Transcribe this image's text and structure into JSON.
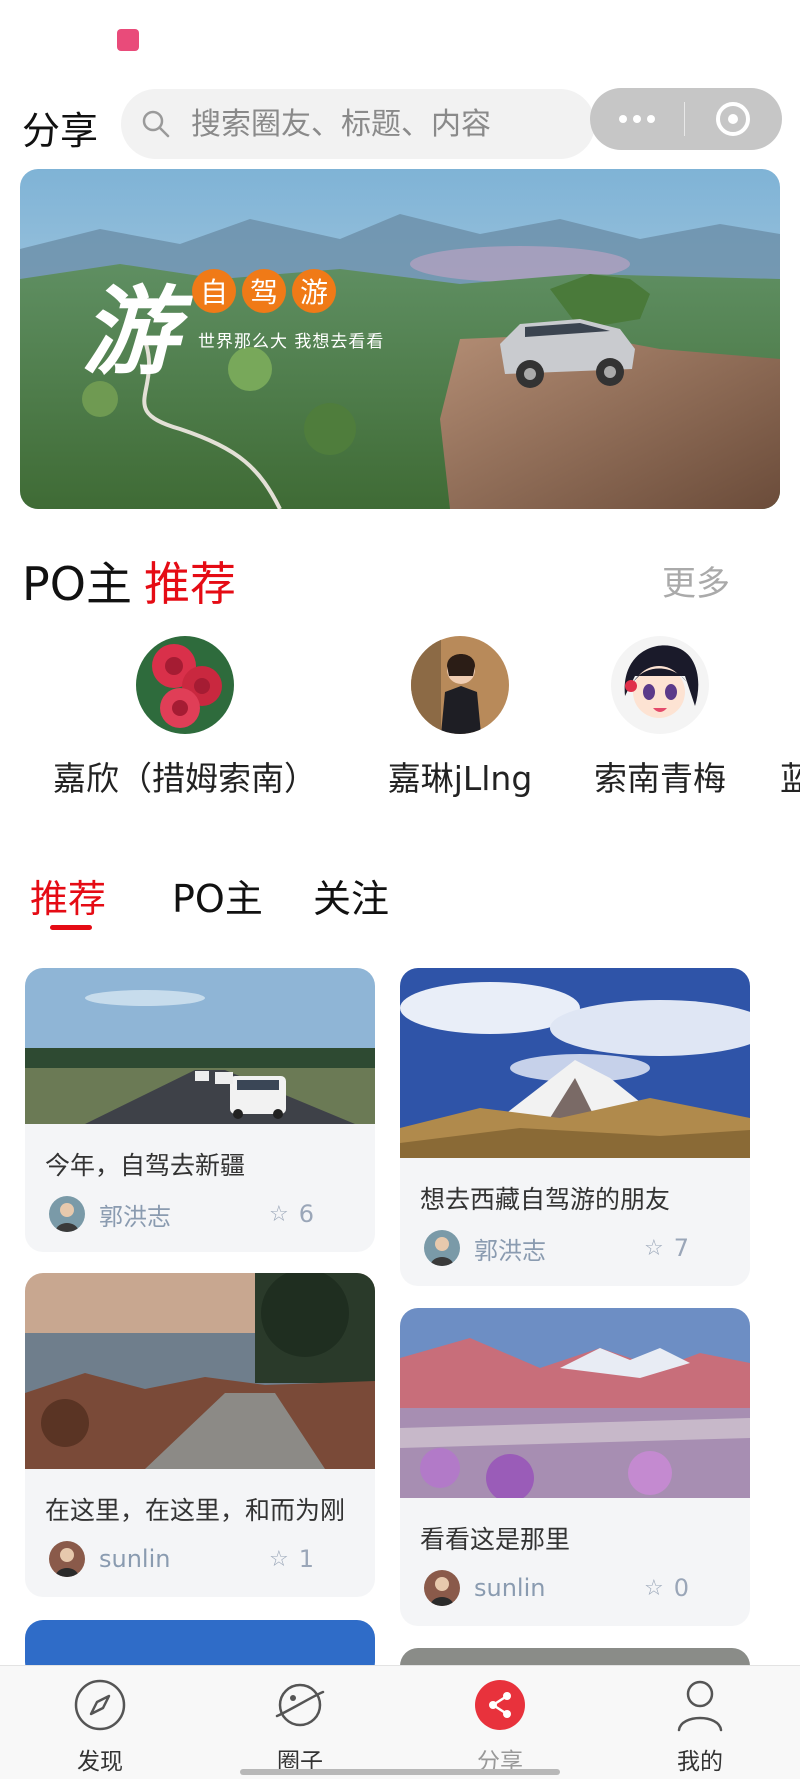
{
  "header": {
    "title": "分享",
    "search_placeholder": "搜索圈友、标题、内容"
  },
  "banner": {
    "brush_char": "游",
    "chips": [
      "自",
      "驾",
      "游"
    ],
    "slogan": "世界那么大 我想去看看"
  },
  "po_section": {
    "title_black": "PO主",
    "title_red": "推荐",
    "more_label": "更多",
    "creators": [
      {
        "name": "嘉欣（措姆索南）",
        "avatar": "roses-avatar"
      },
      {
        "name": "嘉琳jLlng",
        "avatar": "woman-avatar"
      },
      {
        "name": "索南青梅",
        "avatar": "anime-avatar"
      },
      {
        "name": "蓝",
        "avatar": "partial-avatar"
      }
    ]
  },
  "tabs": [
    {
      "label": "推荐",
      "active": true
    },
    {
      "label": "PO主",
      "active": false
    },
    {
      "label": "关注",
      "active": false
    }
  ],
  "posts": [
    {
      "title": "今年，自驾去新疆",
      "author": "郭洪志",
      "likes": "6",
      "image": "road-cars"
    },
    {
      "title": "想去西藏自驾游的朋友",
      "author": "郭洪志",
      "likes": "7",
      "image": "snow-mountain"
    },
    {
      "title": "在这里，在这里，和而为刚",
      "author": "sunlin",
      "likes": "1",
      "image": "coast-path"
    },
    {
      "title": "看看这是那里",
      "author": "sunlin",
      "likes": "0",
      "image": "valley-blossoms"
    }
  ],
  "nav": [
    {
      "label": "发现",
      "icon": "compass-icon"
    },
    {
      "label": "圈子",
      "icon": "planet-icon"
    },
    {
      "label": "分享",
      "icon": "share-icon",
      "active": true
    },
    {
      "label": "我的",
      "icon": "user-icon"
    }
  ],
  "colors": {
    "accent": "#e50b14",
    "banner_chip": "#f07a17",
    "share_active": "#e8323c"
  }
}
